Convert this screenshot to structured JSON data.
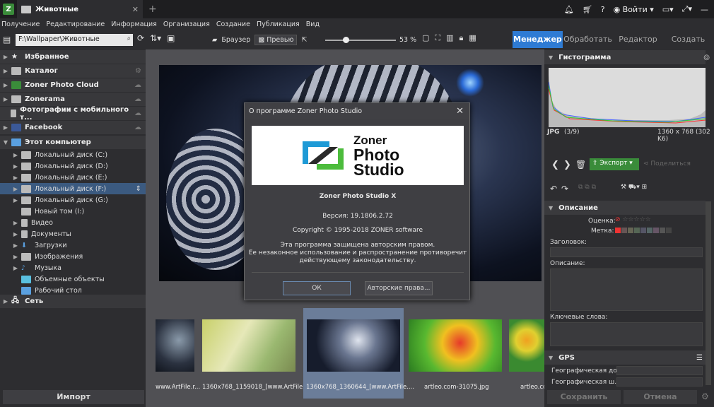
{
  "tab": {
    "title": "Животные"
  },
  "topright": {
    "login": "Войти"
  },
  "menu": [
    "Получение",
    "Редактирование",
    "Информация",
    "Организация",
    "Создание",
    "Публикация",
    "Вид"
  ],
  "toolbar": {
    "path": "F:\\Wallpaper\\Животные",
    "browser": "Браузер",
    "preview": "Превью",
    "zoom": "53 %"
  },
  "modes": [
    "Менеджер",
    "Обработать",
    "Редактор",
    "Создать"
  ],
  "left": {
    "top_items": [
      "Избранное",
      "Каталог",
      "Zoner Photo Cloud",
      "Zonerama",
      "Фотографии с мобильного т...",
      "Facebook",
      "Этот компьютер"
    ],
    "drives": [
      "Локальный диск (C:)",
      "Локальный диск (D:)",
      "Локальный диск (E:)",
      "Локальный диск (F:)",
      "Локальный диск (G:)",
      "Новый том (I:)",
      "Видео",
      "Документы",
      "Загрузки",
      "Изображения",
      "Музыка",
      "Объемные объекты",
      "Рабочий стол"
    ],
    "network": "Сеть",
    "import": "Импорт"
  },
  "thumbs": [
    {
      "caption": "www.ArtFile.r..."
    },
    {
      "caption": "1360x768_1159018_[www.ArtFile..."
    },
    {
      "caption": "1360x768_1360644_[www.ArtFile...."
    },
    {
      "caption": "artleo.com-31075.jpg"
    },
    {
      "caption": "artleo.co..."
    }
  ],
  "right": {
    "histogram_title": "Гистограмма",
    "format": "JPG",
    "position": "(3/9)",
    "dims": "1360 x 768 (302 K6)",
    "export": "Экспорт",
    "share": "Поделиться",
    "description_title": "Описание",
    "rating_label": "Оценка:",
    "mark_label": "Метка:",
    "heading_label": "Заголовок:",
    "description_label": "Описание:",
    "keywords_label": "Ключевые слова:",
    "gps_title": "GPS",
    "geo1": "Географическая до...",
    "geo2": "Географическая ш...",
    "save": "Сохранить",
    "cancel": "Отмена"
  },
  "dialog": {
    "title": "О программе Zoner Photo Studio",
    "logo_line1": "Zoner",
    "logo_line2": "Photo",
    "logo_line3": "Studio",
    "product": "Zoner Photo Studio X",
    "version": "Версия: 19.1806.2.72",
    "copyright": "Copyright © 1995-2018 ZONER software",
    "legal1": "Эта программа защищена авторским правом.",
    "legal2": "Ее незаконное использование и распространение противоречит",
    "legal3": "действующему законодательству.",
    "ok": "ОК",
    "rights": "Авторские права..."
  }
}
